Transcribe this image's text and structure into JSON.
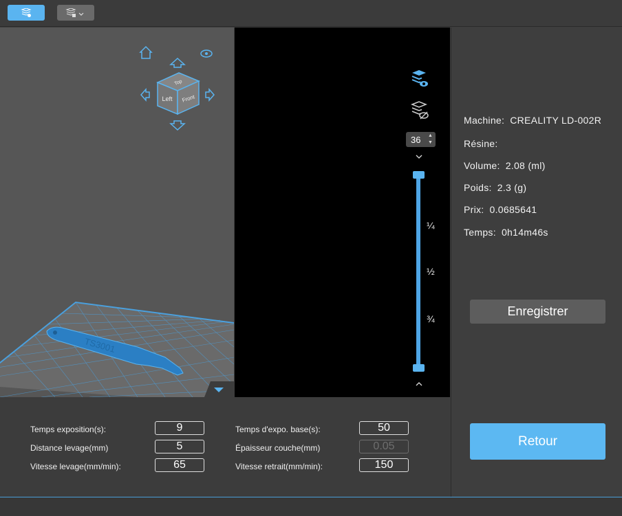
{
  "toolbar": {
    "tool1_icon": "layers-slice-icon",
    "tool2_icon": "layers-dropdown-icon"
  },
  "viewcube": {
    "top": "Top",
    "left": "Left",
    "front": "Front"
  },
  "model": {
    "engraving": "TS3001"
  },
  "preview": {
    "layer_value": "36",
    "fractions": [
      "¼",
      "½",
      "¾"
    ],
    "slider_low_fraction": 0.0,
    "slider_high_fraction": 1.0
  },
  "info": {
    "machine_label": "Machine:",
    "machine_value": "CREALITY LD-002R",
    "resin_label": "Résine:",
    "resin_value": "",
    "volume_label": "Volume:",
    "volume_value": "2.08  (ml)",
    "weight_label": "Poids:",
    "weight_value": "2.3  (g)",
    "price_label": "Prix:",
    "price_value": "0.0685641",
    "time_label": "Temps:",
    "time_value": "0h14m46s"
  },
  "buttons": {
    "save": "Enregistrer",
    "back": "Retour"
  },
  "params": {
    "exposure_label": "Temps exposition(s):",
    "exposure_value": "9",
    "lift_distance_label": "Distance levage(mm)",
    "lift_distance_value": "5",
    "lift_speed_label": "Vitesse levage(mm/min):",
    "lift_speed_value": "65",
    "base_exposure_label": "Temps d'expo. base(s):",
    "base_exposure_value": "50",
    "layer_thickness_label": "Épaisseur couche(mm)",
    "layer_thickness_value": "0.05",
    "retract_speed_label": "Vitesse retrait(mm/min):",
    "retract_speed_value": "150"
  },
  "colors": {
    "accent": "#5ab4f0",
    "panel": "#3e3e3e",
    "viewport": "#565656"
  }
}
